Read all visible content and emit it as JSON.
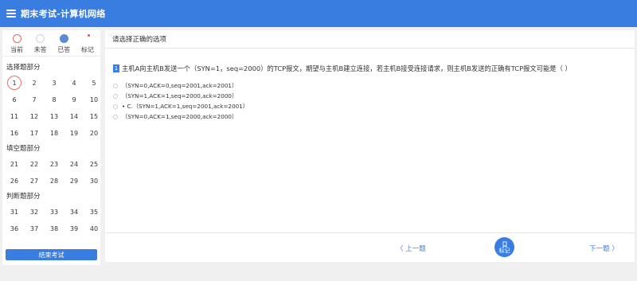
{
  "app": {
    "title": "期末考试-计算机网络"
  },
  "legend": {
    "current": "当前",
    "unanswered": "未答",
    "answered": "已答",
    "marked": "标记"
  },
  "sections": [
    {
      "title": "选择题部分",
      "numbers": [
        "1",
        "2",
        "3",
        "4",
        "5",
        "6",
        "7",
        "8",
        "9",
        "10",
        "11",
        "12",
        "13",
        "14",
        "15",
        "16",
        "17",
        "18",
        "19",
        "20"
      ]
    },
    {
      "title": "填空题部分",
      "numbers": [
        "21",
        "22",
        "23",
        "24",
        "25",
        "26",
        "27",
        "28",
        "29",
        "30"
      ]
    },
    {
      "title": "判断题部分",
      "numbers": [
        "31",
        "32",
        "33",
        "34",
        "35",
        "36",
        "37",
        "38",
        "39",
        "40"
      ]
    }
  ],
  "end_exam_label": "结束考试",
  "main": {
    "header": "请选择正确的选项",
    "question_number": "1",
    "question_text": "主机A向主机B发送一个（SYN=1，seq=2000）的TCP报文，期望与主机B建立连接，若主机B接受连接请求，则主机B发送的正确有TCP报文可能是（ ）",
    "options": [
      "（SYN=0,ACK=0,seq=2001,ack=2001）",
      "（SYN=1,ACK=1,seq=2000,ack=2000）",
      "• C.（SYN=1,ACK=1,seq=2001,ack=2001）",
      "（SYN=0,ACK=1,seq=2000,ack=2000）"
    ]
  },
  "footer": {
    "prev": "〈 上一题",
    "mark": "标记",
    "next": "下一题 〉"
  }
}
